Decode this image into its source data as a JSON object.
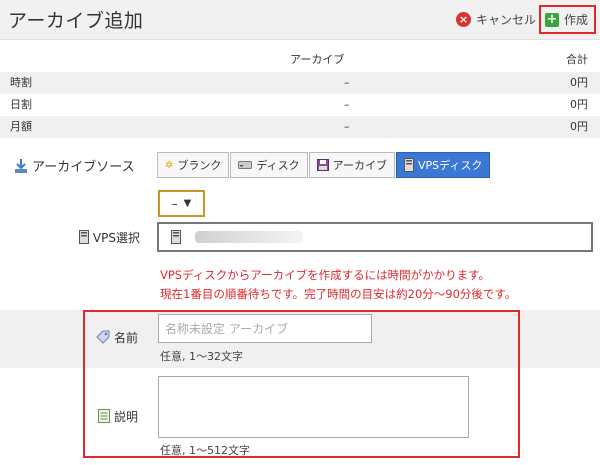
{
  "header": {
    "title": "アーカイブ追加",
    "cancel_label": "キャンセル",
    "create_label": "作成"
  },
  "pricing": {
    "col_archive": "アーカイブ",
    "col_total": "合計",
    "rows": [
      {
        "label": "時割",
        "archive": "–",
        "total": "0円"
      },
      {
        "label": "日割",
        "archive": "–",
        "total": "0円"
      },
      {
        "label": "月額",
        "archive": "–",
        "total": "0円"
      }
    ]
  },
  "source": {
    "label": "アーカイブソース",
    "options": [
      {
        "label": "ブランク",
        "icon": "star-icon"
      },
      {
        "label": "ディスク",
        "icon": "disk-icon"
      },
      {
        "label": "アーカイブ",
        "icon": "floppy-icon"
      },
      {
        "label": "VPSディスク",
        "icon": "server-icon",
        "selected": true
      }
    ]
  },
  "dash_select": {
    "value": "–",
    "arrow": "▼"
  },
  "vps_select": {
    "label": "VPS選択"
  },
  "warning": {
    "line1": "VPSディスクからアーカイブを作成するには時間がかかります。",
    "line2": "現在1番目の順番待ちです。完了時間の目安は約20分～90分後です。"
  },
  "name_field": {
    "label": "名前",
    "placeholder": "名称未設定 アーカイブ",
    "hint": "任意, 1～32文字"
  },
  "desc_field": {
    "label": "説明",
    "hint": "任意, 1～512文字"
  },
  "colors": {
    "accent": "#3b78d6",
    "danger": "#e0282e",
    "success": "#37a53c"
  }
}
